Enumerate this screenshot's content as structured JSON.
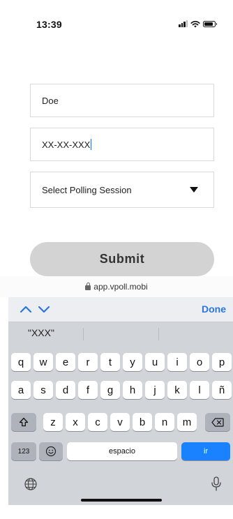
{
  "status_bar": {
    "time": "13:39"
  },
  "form": {
    "last_name_value": "Doe",
    "id_value": "XX-XX-XXX",
    "session_select_value": "Select Polling Session",
    "submit_label": "Submit"
  },
  "browser": {
    "url": "app.vpoll.mobi"
  },
  "keyboard": {
    "done_label": "Done",
    "suggestions": [
      "\"XXX\"",
      "",
      ""
    ],
    "row1": [
      "q",
      "w",
      "e",
      "r",
      "t",
      "y",
      "u",
      "i",
      "o",
      "p"
    ],
    "row2": [
      "a",
      "s",
      "d",
      "f",
      "g",
      "h",
      "j",
      "k",
      "l",
      "ñ"
    ],
    "row3": [
      "z",
      "x",
      "c",
      "v",
      "b",
      "n",
      "m"
    ],
    "numbers_label": "123",
    "space_label": "espacio",
    "go_label": "ir"
  },
  "colors": {
    "accent": "#1b82ff",
    "done_text": "#2a75e2",
    "keyboard_bg": "#d1d4d9",
    "submit_bg": "#d3d3d3"
  }
}
